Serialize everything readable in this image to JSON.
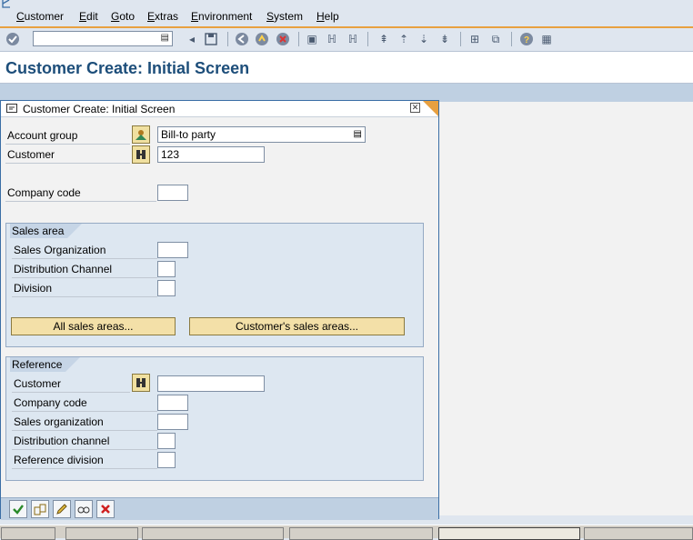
{
  "menu": {
    "items": [
      "Customer",
      "Edit",
      "Goto",
      "Extras",
      "Environment",
      "System",
      "Help"
    ]
  },
  "toolbar": {
    "command_value": "",
    "icons": [
      "enter-icon",
      "save-icon",
      "back-icon",
      "exit-icon",
      "cancel-icon",
      "print-icon",
      "find-icon",
      "find-next-icon",
      "first-page-icon",
      "previous-page-icon",
      "next-page-icon",
      "last-page-icon",
      "create-session-icon",
      "shortcut-icon",
      "help-icon",
      "layout-icon"
    ]
  },
  "page": {
    "title": "Customer Create: Initial Screen"
  },
  "dialog": {
    "title": "Customer Create: Initial Screen",
    "account_group": {
      "label": "Account group",
      "value": "Bill-to party"
    },
    "customer": {
      "label": "Customer",
      "value": "123"
    },
    "company_code": {
      "label": "Company code",
      "value": ""
    },
    "sales_area": {
      "title": "Sales area",
      "sales_org": {
        "label": "Sales Organization",
        "value": ""
      },
      "dist_channel": {
        "label": "Distribution Channel",
        "value": ""
      },
      "division": {
        "label": "Division",
        "value": ""
      },
      "btn_all": "All sales areas...",
      "btn_customer": "Customer's sales areas..."
    },
    "reference": {
      "title": "Reference",
      "customer": {
        "label": "Customer",
        "value": ""
      },
      "company_code": {
        "label": "Company code",
        "value": ""
      },
      "sales_org": {
        "label": "Sales organization",
        "value": ""
      },
      "dist_channel": {
        "label": "Distribution channel",
        "value": ""
      },
      "division": {
        "label": "Reference division",
        "value": ""
      }
    },
    "footer_buttons": [
      "continue-icon",
      "choose-icon",
      "edit-icon",
      "glasses-icon",
      "cancel-icon"
    ]
  },
  "colors": {
    "title": "#1d4e7a",
    "accent": "#e8a040",
    "group_bg": "#dde7f1"
  }
}
